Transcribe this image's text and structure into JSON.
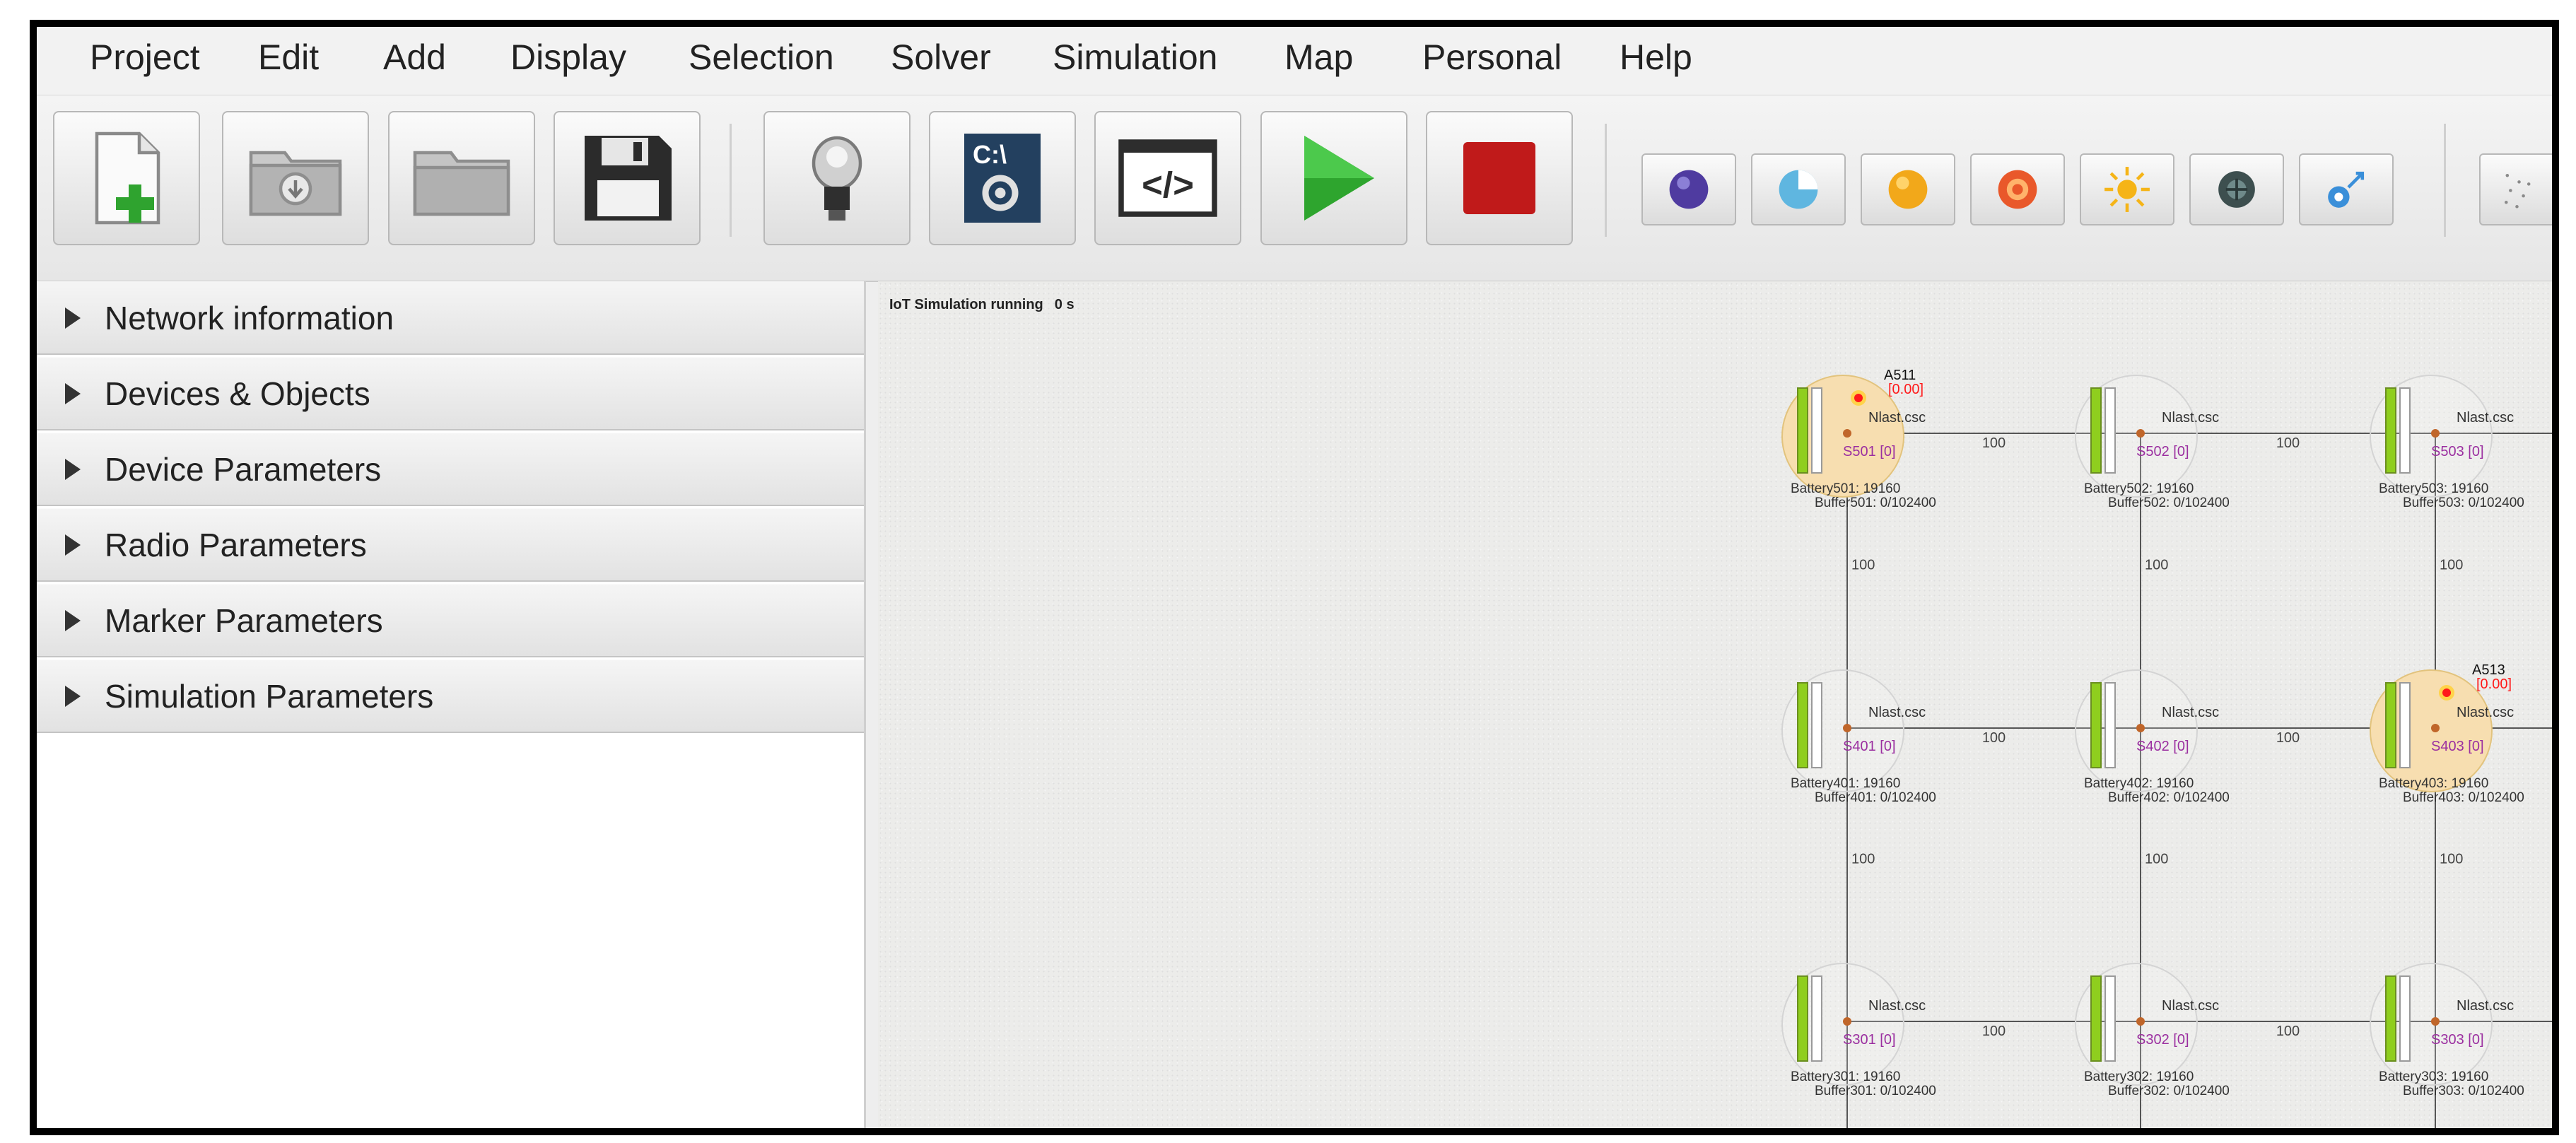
{
  "menu": [
    "Project",
    "Edit",
    "Add",
    "Display",
    "Selection",
    "Solver",
    "Simulation",
    "Map",
    "Personal",
    "Help"
  ],
  "toolbar": {
    "buttons": [
      "new-project",
      "import",
      "open-folder",
      "save",
      "bulb",
      "console",
      "code",
      "run",
      "stop"
    ],
    "sensor_buttons": [
      "purple-sphere",
      "blue-pie",
      "orange-sphere",
      "red-ring",
      "sun",
      "gas",
      "mobile-marker",
      "scatter"
    ]
  },
  "panel": {
    "sections": [
      "Network information",
      "Devices & Objects",
      "Device Parameters",
      "Radio Parameters",
      "Marker Parameters",
      "Simulation Parameters"
    ]
  },
  "simulation": {
    "status": "IoT Simulation running",
    "time": "0 s"
  },
  "network": {
    "nodes": [
      {
        "id": "S501",
        "label": "S501 [0]",
        "script": "Nlast.csc",
        "battery": "Battery501: 19160",
        "buffer": "Buffer501: 0/102400",
        "active": true,
        "agent": {
          "name": "A511",
          "value": "[0.00]"
        }
      },
      {
        "id": "S502",
        "label": "S502 [0]",
        "script": "Nlast.csc",
        "battery": "Battery502: 19160",
        "buffer": "Buffer502: 0/102400",
        "active": false
      },
      {
        "id": "S503",
        "label": "S503 [0]",
        "script": "Nlast.csc",
        "battery": "Battery503: 19160",
        "buffer": "Buffer503: 0/102400",
        "active": false
      },
      {
        "id": "S401",
        "label": "S401 [0]",
        "script": "Nlast.csc",
        "battery": "Battery401: 19160",
        "buffer": "Buffer401: 0/102400",
        "active": false
      },
      {
        "id": "S402",
        "label": "S402 [0]",
        "script": "Nlast.csc",
        "battery": "Battery402: 19160",
        "buffer": "Buffer402: 0/102400",
        "active": false
      },
      {
        "id": "S403",
        "label": "S403 [0]",
        "script": "Nlast.csc",
        "battery": "Battery403: 19160",
        "buffer": "Buffer403: 0/102400",
        "active": true,
        "agent": {
          "name": "A513",
          "value": "[0.00]"
        }
      },
      {
        "id": "S301",
        "label": "S301 [0]",
        "script": "Nlast.csc",
        "battery": "Battery301: 19160",
        "buffer": "Buffer301: 0/102400",
        "active": false
      },
      {
        "id": "S302",
        "label": "S302 [0]",
        "script": "Nlast.csc",
        "battery": "Battery302: 19160",
        "buffer": "Buffer302: 0/102400",
        "active": false
      },
      {
        "id": "S303",
        "label": "S303 [0]",
        "script": "Nlast.csc",
        "battery": "Battery303: 19160",
        "buffer": "Buffer303: 0/102400",
        "active": false
      }
    ],
    "link_weight": "100",
    "colors": {
      "link": "#555555",
      "node_dot": "#c0662a",
      "label": "#9b2fa0",
      "agent": "#ff1a1a",
      "active_halo": "#f7deb0",
      "battery": "#8fce1e"
    }
  }
}
